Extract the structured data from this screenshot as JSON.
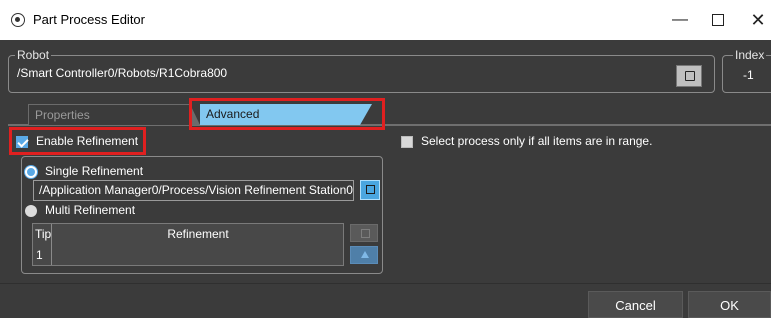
{
  "window": {
    "title": "Part Process Editor",
    "minimize_glyph": "—",
    "close_glyph": "✕"
  },
  "robot": {
    "legend": "Robot",
    "path": "/Smart Controller0/Robots/R1Cobra800"
  },
  "index": {
    "legend": "Index",
    "value": "-1"
  },
  "tabs": [
    {
      "label": "Properties",
      "selected": false
    },
    {
      "label": "Advanced",
      "selected": true
    }
  ],
  "options": {
    "enable_refinement_label": "Enable Refinement",
    "enable_refinement_checked": true,
    "select_in_range_label": "Select process only if all items are in range.",
    "select_in_range_checked": false
  },
  "refinement": {
    "single_label": "Single Refinement",
    "single_selected": true,
    "single_path": "/Application Manager0/Process/Vision Refinement Station0",
    "multi_label": "Multi Refinement",
    "multi_selected": false,
    "table": {
      "columns": [
        "Tip",
        "Refinement"
      ],
      "rows": [
        {
          "tip": "1",
          "refinement": ""
        }
      ]
    }
  },
  "buttons": {
    "cancel": "Cancel",
    "ok": "OK"
  },
  "colors": {
    "background": "#3b3b3b",
    "accent": "#5aa9e6",
    "tab_selected": "#82c8f0",
    "highlight": "#e02020"
  },
  "icons": [
    "window-icon",
    "minimize-icon",
    "maximize-icon",
    "close-icon",
    "browse-icon",
    "up-arrow-icon"
  ]
}
